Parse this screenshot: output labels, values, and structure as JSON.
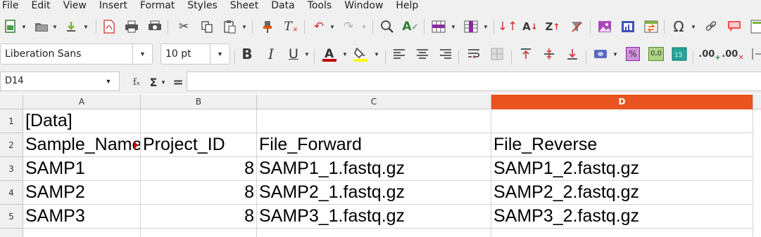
{
  "menubar": [
    "File",
    "Edit",
    "View",
    "Insert",
    "Format",
    "Styles",
    "Sheet",
    "Data",
    "Tools",
    "Window",
    "Help"
  ],
  "toolbar": {
    "font_name": "Liberation Sans",
    "font_size": "10 pt",
    "bold": "B",
    "italic": "I",
    "underline": "U",
    "percent": "%",
    "number_format": "0,0",
    "add_decimal": ".00",
    "del_decimal": ".00",
    "function_wizard": "fₓ",
    "sum": "Σ",
    "formula": "="
  },
  "formula_bar": {
    "cell_reference": "D14",
    "content": ""
  },
  "sheet": {
    "columns": [
      "A",
      "B",
      "C",
      "D"
    ],
    "active_column": "D",
    "rows": [
      {
        "num": "1",
        "cells": [
          "[Data]",
          "",
          "",
          ""
        ]
      },
      {
        "num": "2",
        "cells": [
          "Sample_Name",
          "Project_ID",
          "File_Forward",
          "File_Reverse"
        ]
      },
      {
        "num": "3",
        "cells": [
          "SAMP1",
          "8",
          "SAMP1_1.fastq.gz",
          "SAMP1_2.fastq.gz"
        ]
      },
      {
        "num": "4",
        "cells": [
          "SAMP2",
          "8",
          "SAMP2_1.fastq.gz",
          "SAMP2_2.fastq.gz"
        ]
      },
      {
        "num": "5",
        "cells": [
          "SAMP3",
          "8",
          "SAMP3_1.fastq.gz",
          "SAMP3_2.fastq.gz"
        ]
      }
    ]
  },
  "colors": {
    "active_header": "#e95420",
    "font_color": "#c00000",
    "highlight_color": "#ffff00"
  }
}
